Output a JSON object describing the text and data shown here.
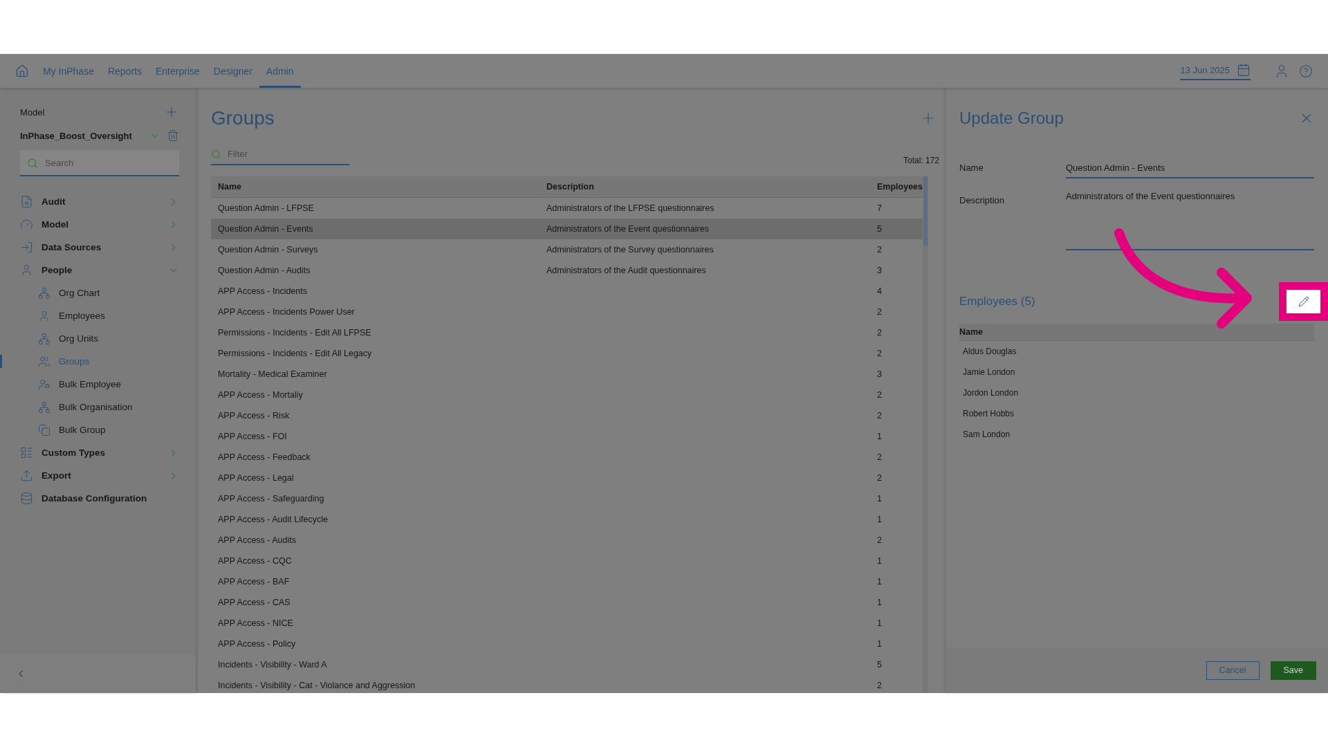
{
  "nav": {
    "items": [
      {
        "label": "My InPhase",
        "selected": false
      },
      {
        "label": "Reports",
        "selected": false
      },
      {
        "label": "Enterprise",
        "selected": false
      },
      {
        "label": "Designer",
        "selected": false
      },
      {
        "label": "Admin",
        "selected": true
      }
    ],
    "date": "13 Jun 2025"
  },
  "sidebar": {
    "model_label": "Model",
    "model_value": "InPhase_Boost_Oversight",
    "search_placeholder": "Search",
    "items": [
      {
        "label": "Audit",
        "kind": "group",
        "expanded": false
      },
      {
        "label": "Model",
        "kind": "group",
        "expanded": false
      },
      {
        "label": "Data Sources",
        "kind": "group",
        "expanded": false
      },
      {
        "label": "People",
        "kind": "group",
        "expanded": true,
        "children": [
          {
            "label": "Org Chart",
            "selected": false
          },
          {
            "label": "Employees",
            "selected": false
          },
          {
            "label": "Org Units",
            "selected": false
          },
          {
            "label": "Groups",
            "selected": true
          },
          {
            "label": "Bulk Employee",
            "selected": false
          },
          {
            "label": "Bulk Organisation",
            "selected": false
          },
          {
            "label": "Bulk Group",
            "selected": false
          }
        ]
      },
      {
        "label": "Custom Types",
        "kind": "group",
        "expanded": false
      },
      {
        "label": "Export",
        "kind": "group",
        "expanded": false
      },
      {
        "label": "Database Configuration",
        "kind": "link"
      }
    ]
  },
  "groups": {
    "title": "Groups",
    "filter_placeholder": "Filter",
    "total": "Total: 172",
    "columns": [
      "Name",
      "Description",
      "Employees"
    ],
    "rows": [
      {
        "cells": [
          "Question Admin - LFPSE",
          "Administrators of the LFPSE questionnaires",
          "7"
        ],
        "selected": false
      },
      {
        "cells": [
          "Question Admin - Events",
          "Administrators of the Event questionnaires",
          "5"
        ],
        "selected": true
      },
      {
        "cells": [
          "Question Admin - Surveys",
          "Administrators of the Survey questionnaires",
          "2"
        ],
        "selected": false
      },
      {
        "cells": [
          "Question Admin - Audits",
          "Administrators of the Audit questionnaires",
          "3"
        ],
        "selected": false
      },
      {
        "cells": [
          "APP Access - Incidents",
          "",
          "4"
        ],
        "selected": false
      },
      {
        "cells": [
          "APP Access - Incidents Power User",
          "",
          "2"
        ],
        "selected": false
      },
      {
        "cells": [
          "Permissions - Incidents - Edit All LFPSE",
          "",
          "2"
        ],
        "selected": false
      },
      {
        "cells": [
          "Permissions - Incidents - Edit All Legacy",
          "",
          "2"
        ],
        "selected": false
      },
      {
        "cells": [
          "Mortality - Medical Examiner",
          "",
          "3"
        ],
        "selected": false
      },
      {
        "cells": [
          "APP Access - Mortaliy",
          "",
          "2"
        ],
        "selected": false
      },
      {
        "cells": [
          "APP Access - Risk",
          "",
          "2"
        ],
        "selected": false
      },
      {
        "cells": [
          "APP Access - FOI",
          "",
          "1"
        ],
        "selected": false
      },
      {
        "cells": [
          "APP Access - Feedback",
          "",
          "2"
        ],
        "selected": false
      },
      {
        "cells": [
          "APP Access - Legal",
          "",
          "2"
        ],
        "selected": false
      },
      {
        "cells": [
          "APP Access - Safeguarding",
          "",
          "1"
        ],
        "selected": false
      },
      {
        "cells": [
          "APP Access - Audit Lifecycle",
          "",
          "1"
        ],
        "selected": false
      },
      {
        "cells": [
          "APP Access - Audits",
          "",
          "2"
        ],
        "selected": false
      },
      {
        "cells": [
          "APP Access - CQC",
          "",
          "1"
        ],
        "selected": false
      },
      {
        "cells": [
          "APP Access - BAF",
          "",
          "1"
        ],
        "selected": false
      },
      {
        "cells": [
          "APP Access - CAS",
          "",
          "1"
        ],
        "selected": false
      },
      {
        "cells": [
          "APP Access - NICE",
          "",
          "1"
        ],
        "selected": false
      },
      {
        "cells": [
          "APP Access - Policy",
          "",
          "1"
        ],
        "selected": false
      },
      {
        "cells": [
          "Incidents - Visibility - Ward A",
          "",
          "5"
        ],
        "selected": false
      },
      {
        "cells": [
          "Incidents - Visibility - Cat - Violance and Aggression",
          "",
          "2"
        ],
        "selected": false
      }
    ]
  },
  "update_group": {
    "title": "Update Group",
    "name_label": "Name",
    "name_value": "Question Admin - Events",
    "description_label": "Description",
    "description_value": "Administrators of the Event questionnaires",
    "employees_title": "Employees (5)",
    "employees_column": "Name",
    "employees": [
      "Aldus Douglas",
      "Jamie London",
      "Jordon London",
      "Robert Hobbs",
      "Sam London"
    ],
    "cancel": "Cancel",
    "save": "Save"
  }
}
